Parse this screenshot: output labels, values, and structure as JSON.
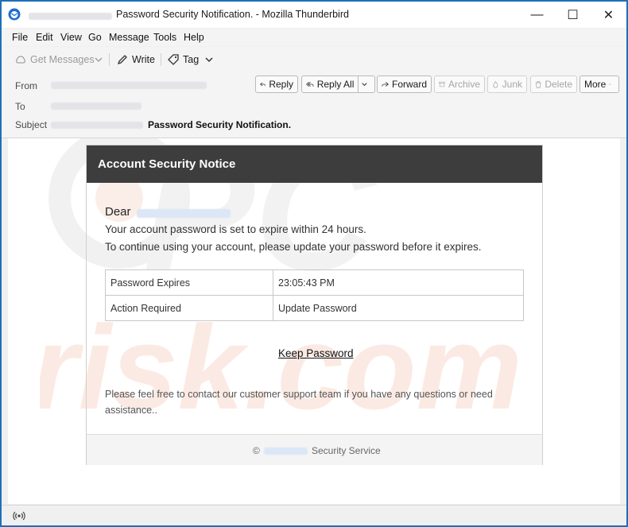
{
  "window": {
    "title_blurred": "",
    "title": "Password Security Notification. - Mozilla Thunderbird",
    "controls": {
      "minimize": "—",
      "maximize": "☐",
      "close": "✕"
    }
  },
  "menu": [
    "File",
    "Edit",
    "View",
    "Go",
    "Message",
    "Tools",
    "Help"
  ],
  "toolbar": {
    "get_messages": "Get Messages",
    "write": "Write",
    "tag": "Tag"
  },
  "header": {
    "from_label": "From",
    "to_label": "To",
    "subject_label": "Subject",
    "subject": "Password Security Notification.",
    "buttons": {
      "reply": "Reply",
      "reply_all": "Reply All",
      "forward": "Forward",
      "archive": "Archive",
      "junk": "Junk",
      "delete": "Delete",
      "more": "More"
    }
  },
  "email": {
    "header_title": "Account Security Notice",
    "greeting": "Dear",
    "line1": "Your account password is set to expire within 24 hours.",
    "line2": "To continue using your account, please update your password before it expires.",
    "table": [
      [
        "Password Expires",
        "23:05:43 PM"
      ],
      [
        "Action Required",
        "Update Password"
      ]
    ],
    "link": "Keep Password",
    "support": "Please feel free to contact our customer support team if you have any questions or need assistance..",
    "footer_copyright": "©",
    "footer_text": "Security Service"
  },
  "colors": {
    "window_border": "#1f6fb8",
    "email_header_bg": "#3d3d3d",
    "watermark": "#f2f2f2",
    "watermark_accent": "#fbe9e2"
  }
}
